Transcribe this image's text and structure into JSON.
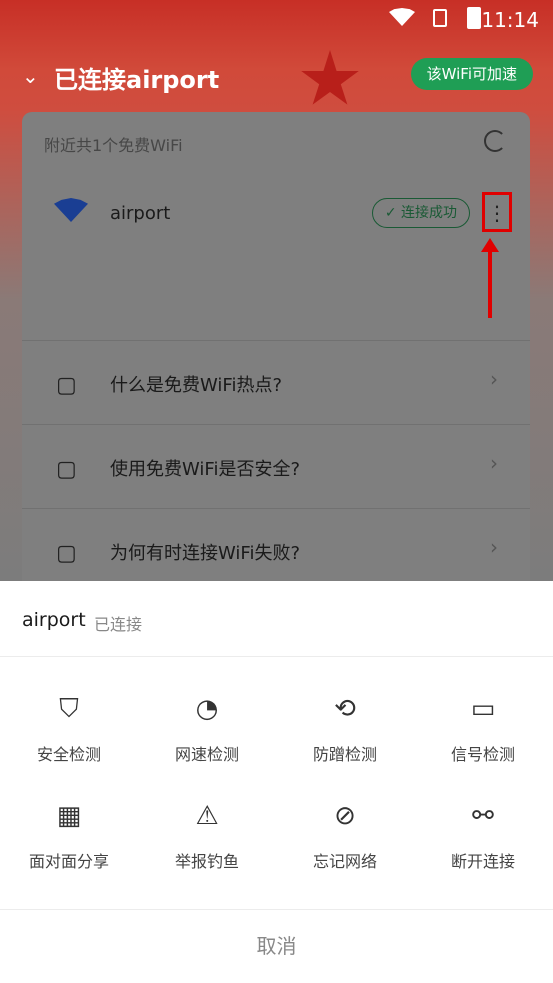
{
  "status": {
    "time": "11:14"
  },
  "header": {
    "title": "已连接airport",
    "accelerate": "该WiFi可加速"
  },
  "card": {
    "hint": "附近共1个免费WiFi",
    "network": {
      "ssid": "airport",
      "status_badge": "连接成功"
    },
    "faq": [
      "什么是免费WiFi热点?",
      "使用免费WiFi是否安全?",
      "为何有时连接WiFi失败?"
    ]
  },
  "sheet": {
    "network_name": "airport",
    "network_state": "已连接",
    "actions": [
      {
        "label": "安全检测",
        "icon": "shield-icon"
      },
      {
        "label": "网速检测",
        "icon": "speedometer-icon"
      },
      {
        "label": "防蹭检测",
        "icon": "lock-shield-icon"
      },
      {
        "label": "信号检测",
        "icon": "router-icon"
      },
      {
        "label": "面对面分享",
        "icon": "qr-code-icon"
      },
      {
        "label": "举报钓鱼",
        "icon": "warning-icon"
      },
      {
        "label": "忘记网络",
        "icon": "forbid-icon"
      },
      {
        "label": "断开连接",
        "icon": "unlink-icon"
      }
    ],
    "cancel": "取消"
  },
  "colors": {
    "accent_green": "#1f9e55",
    "annotation_red": "#e00000",
    "wifi_blue": "#1a3e93"
  }
}
